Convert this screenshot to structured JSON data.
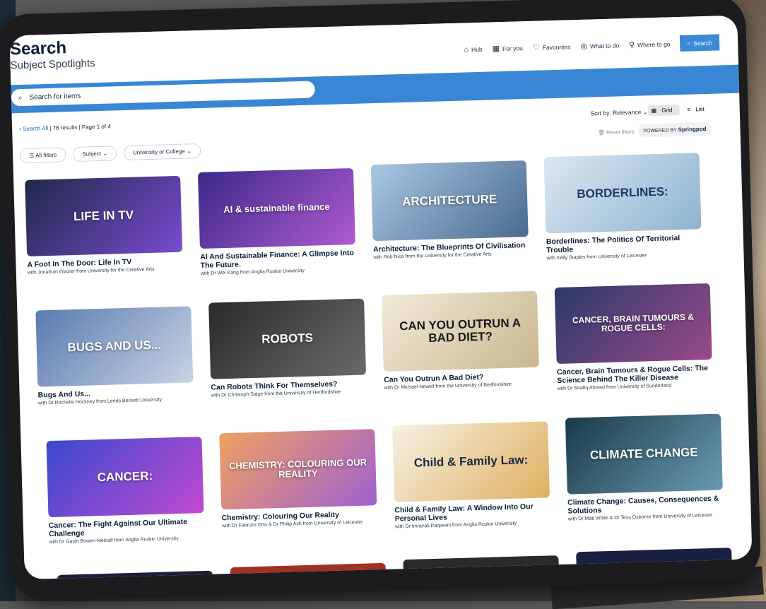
{
  "header": {
    "title": "Search",
    "subtitle": "Subject Spotlights",
    "nav": [
      {
        "label": "Hub",
        "icon": "home-icon"
      },
      {
        "label": "For you",
        "icon": "grid-icon"
      },
      {
        "label": "Favourites",
        "icon": "heart-icon"
      },
      {
        "label": "What to do",
        "icon": "compass-icon"
      },
      {
        "label": "Where to go",
        "icon": "location-icon"
      }
    ],
    "search_tab": "Search"
  },
  "search": {
    "placeholder": "Search for items"
  },
  "results": {
    "back_label": "Search All",
    "count": "78 results",
    "page": "Page 1 of 4",
    "sort_label": "Sort by:",
    "sort_value": "Relevance",
    "view_grid": "Grid",
    "view_list": "List",
    "reset": "Reset filters",
    "powered_prefix": "POWERED BY",
    "powered_brand": "Springpod"
  },
  "filters": [
    "All filters",
    "Subject",
    "University or College"
  ],
  "cards": [
    {
      "thumb": "LIFE IN TV",
      "title": "A Foot In The Door: Life In TV",
      "by": "with Jonathan Glazier from University for the Creative Arts",
      "color": "#3a3a6a"
    },
    {
      "thumb": "AI & sustainable finance",
      "title": "AI And Sustainable Finance: A Glimpse Into The Future.",
      "by": "with Dr Wei Kang from Anglia Ruskin University",
      "color": "#6a3fb0"
    },
    {
      "thumb": "ARCHITECTURE",
      "title": "Architecture: The Blueprints Of Civilisation",
      "by": "with Rob Nice from the University for the Creative Arts",
      "color": "#7a9fc4"
    },
    {
      "thumb": "BORDERLINES:",
      "title": "Borderlines: The Politics Of Territorial Trouble",
      "by": "with Kelly Staples from University of Leicester",
      "color": "#9fb8d0"
    },
    {
      "thumb": "BUGS AND US...",
      "title": "Bugs And Us...",
      "by": "with Dr Rochelle Hockney from Leeds Beckett University",
      "color": "#4a6a9a"
    },
    {
      "thumb": "ROBOTS",
      "title": "Can Robots Think For Themselves?",
      "by": "with Dr Christoph Salge from the University of Hertfordshire",
      "color": "#3a3a3a"
    },
    {
      "thumb": "CAN YOU OUTRUN A BAD DIET?",
      "title": "Can You Outrun A Bad Diet?",
      "by": "with Dr Michael Newell from the University of Bedfordshire",
      "color": "#d8c8a8"
    },
    {
      "thumb": "CANCER, BRAIN TUMOURS & ROGUE CELLS:",
      "title": "Cancer, Brain Tumours & Rogue Cells: The Science Behind The Killer Disease",
      "by": "with Dr Shafiq Ahmed from University of Sunderland",
      "color": "#3a4a7a"
    },
    {
      "thumb": "CANCER:",
      "title": "Cancer: The Fight Against Our Ultimate Challenge",
      "by": "with Dr Gavin Bowen-Metcalf from Anglia Ruskin University",
      "color": "#6a4ab0"
    },
    {
      "thumb": "CHEMISTRY: COLOURING OUR REALITY",
      "title": "Chemistry: Colouring Our Reality",
      "by": "with Dr Fabrizio Ortu & Dr Philip Ash from University of Leicester",
      "color": "#d09070"
    },
    {
      "thumb": "Child & Family Law:",
      "title": "Child & Family Law: A Window Into Our Personal Lives",
      "by": "with Dr Imranali Panjwani from Anglia Ruskin University",
      "color": "#d8b878"
    },
    {
      "thumb": "CLIMATE CHANGE",
      "title": "Climate Change: Causes, Consequences & Solutions",
      "by": "with Dr Matt Wilde & Dr Tess Osborne from University of Leicester",
      "color": "#2a5a6a"
    }
  ]
}
